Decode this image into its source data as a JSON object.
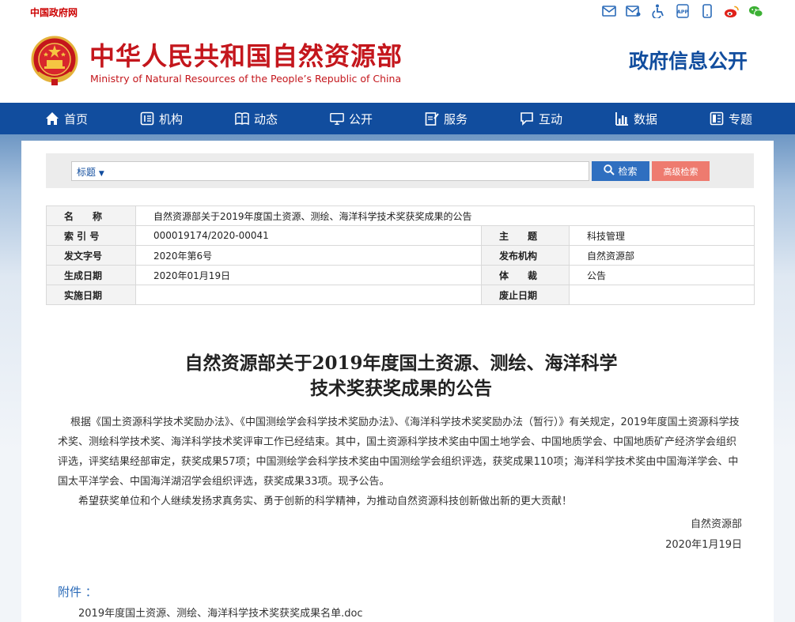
{
  "topbar": {
    "gov_link": "中国政府网",
    "icons": [
      "mail-icon",
      "email-icon",
      "accessibility-icon",
      "app-icon",
      "mobile-icon",
      "weibo-icon",
      "wechat-icon"
    ]
  },
  "header": {
    "cn_title": "中华人民共和国自然资源部",
    "en_title": "Ministry of Natural Resources of the People’s Republic of China",
    "right_title": "政府信息公开"
  },
  "nav": {
    "items": [
      {
        "label": "首页",
        "icon": "home-icon"
      },
      {
        "label": "机构",
        "icon": "org-icon"
      },
      {
        "label": "动态",
        "icon": "book-icon"
      },
      {
        "label": "公开",
        "icon": "monitor-icon"
      },
      {
        "label": "服务",
        "icon": "edit-icon"
      },
      {
        "label": "互动",
        "icon": "chat-icon"
      },
      {
        "label": "数据",
        "icon": "chart-icon"
      },
      {
        "label": "专题",
        "icon": "topic-icon"
      }
    ]
  },
  "search": {
    "select_label": "标题",
    "select_arrow": "▼",
    "input_value": "",
    "search_button": "检索",
    "advanced_button": "高级检索"
  },
  "meta": {
    "name_label": "名　　称",
    "name_value": "自然资源部关于2019年度国土资源、测绘、海洋科学技术奖获奖成果的公告",
    "index_label": "索 引 号",
    "index_value": "000019174/2020-00041",
    "topic_label": "主　　题",
    "topic_value": "科技管理",
    "doc_no_label": "发文字号",
    "doc_no_value": "2020年第6号",
    "publisher_label": "发布机构",
    "publisher_value": "自然资源部",
    "created_label": "生成日期",
    "created_value": "2020年01月19日",
    "genre_label": "体　　裁",
    "genre_value": "公告",
    "effective_label": "实施日期",
    "effective_value": "",
    "expire_label": "废止日期",
    "expire_value": ""
  },
  "article": {
    "title_line1": "自然资源部关于2019年度国土资源、测绘、海洋科学",
    "title_line2": "技术奖获奖成果的公告",
    "paragraph1": "根据《国土资源科学技术奖励办法》、《中国测绘学会科学技术奖励办法》、《海洋科学技术奖奖励办法（暂行）》有关规定，2019年度国土资源科学技术奖、测绘科学技术奖、海洋科学技术奖评审工作已经结束。其中，国土资源科学技术奖由中国土地学会、中国地质学会、中国地质矿产经济学会组织评选，评奖结果经部审定，获奖成果57项；中国测绘学会科学技术奖由中国测绘学会组织评选，获奖成果110项；海洋科学技术奖由中国海洋学会、中国太平洋学会、中国海洋湖沼学会组织评选，获奖成果33项。现予公告。",
    "paragraph2": "希望获奖单位和个人继续发扬求真务实、勇于创新的科学精神，为推动自然资源科技创新做出新的更大贡献！",
    "signature": "自然资源部",
    "date": "2020年1月19日",
    "attachment_label": "附件 ：",
    "attachment_file": "2019年度国土资源、测绘、海洋科学技术奖获奖成果名单.doc"
  },
  "colors": {
    "brand_red": "#c4161c",
    "nav_blue": "#114d9e",
    "search_blue": "#2f6fc0",
    "advanced_red": "#ee7b6f"
  }
}
